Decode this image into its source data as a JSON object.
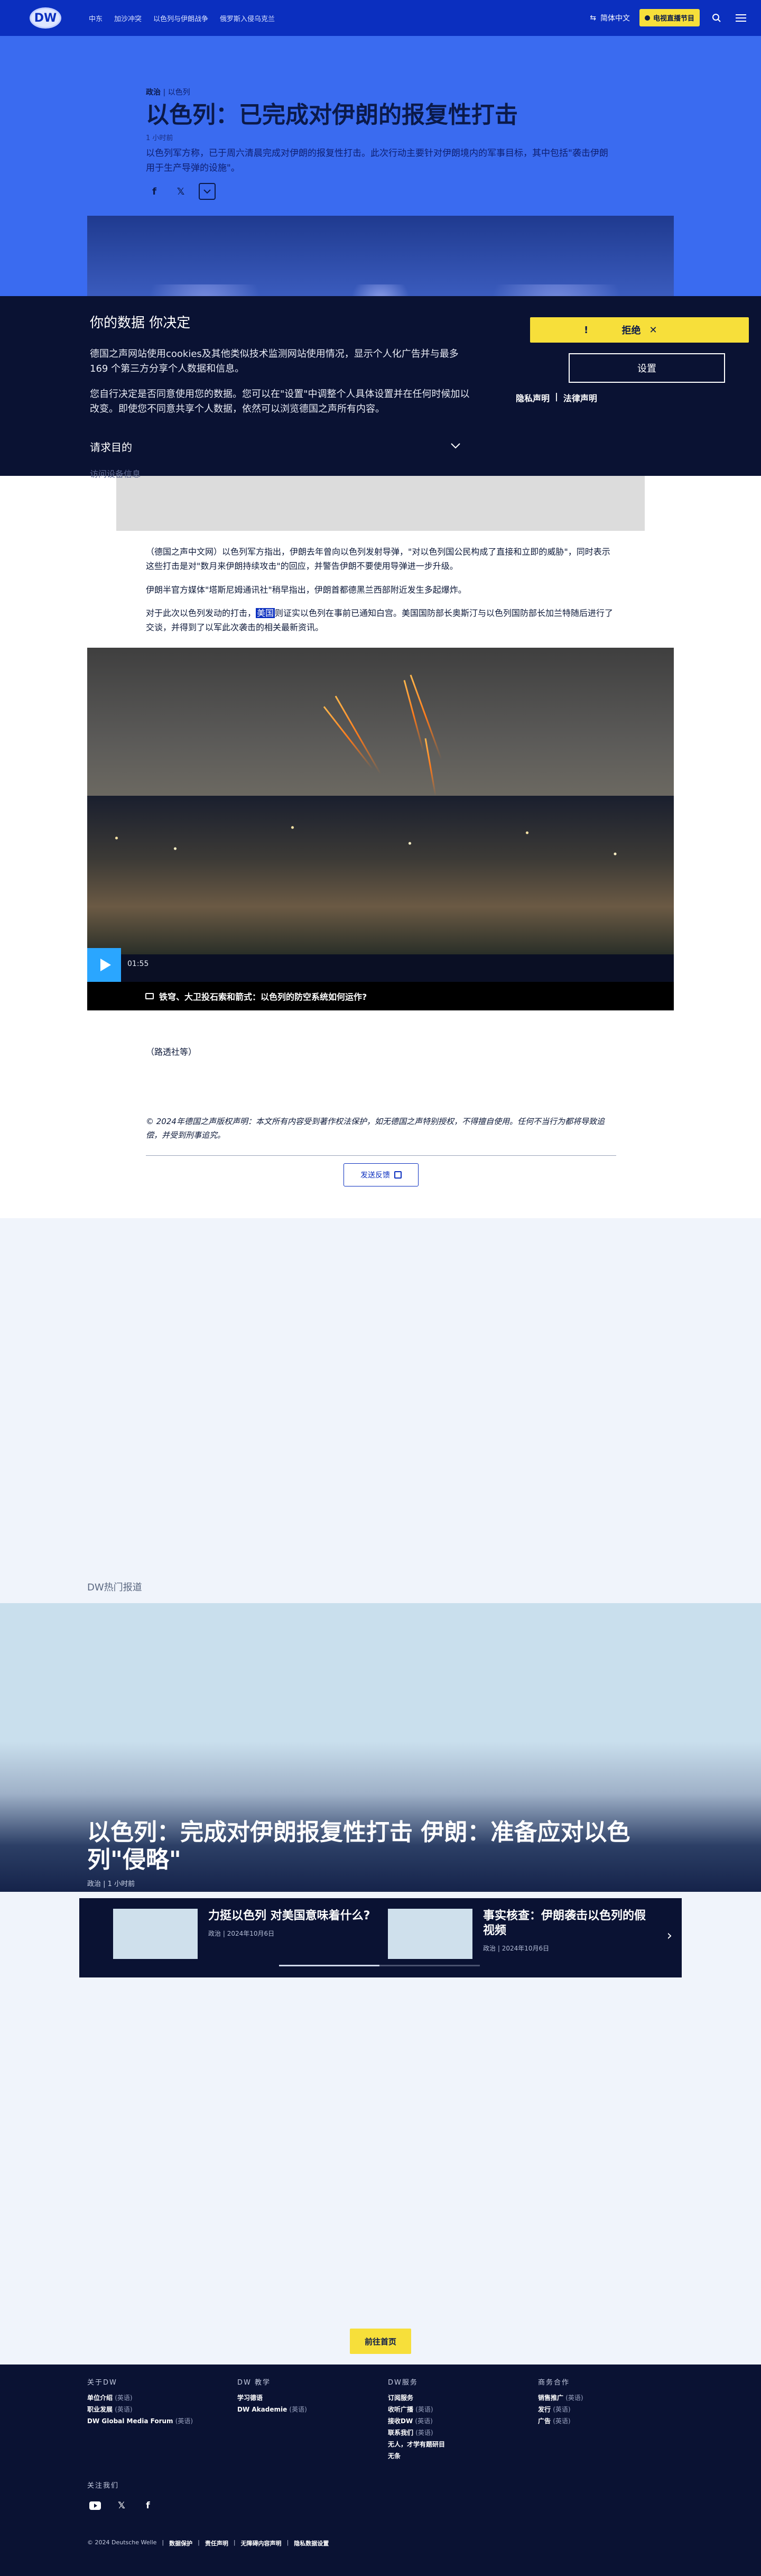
{
  "header": {
    "logo": "DW",
    "nav": [
      "中东",
      "加沙冲突",
      "以色列与伊朗战争",
      "俄罗斯入侵乌克兰"
    ],
    "language": "简体中文",
    "live_label": "电视直播节目"
  },
  "article": {
    "kicker": "政治",
    "kicker_tag": "以色列",
    "title": "以色列：已完成对伊朗的报复性打击",
    "time": "1 小时前",
    "lead": "以色列军方称，已于周六清晨完成对伊朗的报复性打击。此次行动主要针对伊朗境内的军事目标，其中包括\"袭击伊朗用于生产导弹的设施\"。",
    "paragraphs": [
      "（德国之声中文网）以色列军方指出，伊朗去年曾向以色列发射导弹，\"对以色列国公民构成了直接和立即的威胁\"，同时表示这些打击是对\"数月来伊朗持续攻击\"的回应，并警告伊朗不要使用导弹进一步升级。",
      "伊朗半官方媒体\"塔斯尼姆通讯社\"稍早指出，伊朗首都德黑兰西部附近发生多起爆炸。"
    ],
    "p3_before": "对于此次以色列发动的打击，",
    "p3_highlight": "美国",
    "p3_after": "则证实以色列在事前已通知白宫。美国国防部长奥斯汀与以色列国防部长加兰特随后进行了交谈，并得到了以军此次袭击的相关最新资讯。",
    "video_duration": "01:55",
    "video_caption": "铁穹、大卫投石索和箭式：以色列的防空系统如何运作?",
    "source": "（路透社等）",
    "copyright": "© 2024年德国之声版权声明：本文所有内容受到著作权法保护，如无德国之声特别授权，不得擅自使用。任何不当行为都将导致追偿，并受到刑事追究。",
    "feedback_label": "发送反馈"
  },
  "cookie": {
    "title": "你的数据 你决定",
    "p1": "德国之声网站使用cookies及其他类似技术监测网站使用情况，显示个人化广告并与最多169 个第三方分享个人数据和信息。",
    "p2": "您自行决定是否同意使用您的数据。您可以在\"设置\"中调整个人具体设置并在任何时候加以改变。即使您不同意共享个人数据，依然可以浏览德国之声所有内容。",
    "purpose": "请求目的",
    "peek_text": "访问设备信息",
    "reject_label": "拒绝",
    "settings_label": "设置",
    "privacy_label": "隐私声明",
    "legal_label": "法律声明"
  },
  "hot": {
    "label": "DW热门报道",
    "title": "以色列：完成对伊朗报复性打击 伊朗：准备应对以色列\"侵略\"",
    "meta_cat": "政治",
    "meta_time": "1 小时前",
    "cards": [
      {
        "title": "力挺以色列 对美国意味着什么?",
        "cat": "政治",
        "date": "2024年10月6日"
      },
      {
        "title": "事实核查：伊朗袭击以色列的假视频",
        "cat": "政治",
        "date": "2024年10月6日"
      }
    ],
    "progress_fraction": 0.5
  },
  "home_button": "前往首页",
  "footer": {
    "cols": [
      {
        "title": "关于DW",
        "items": [
          {
            "label": "单位介绍",
            "note": "(英语)"
          },
          {
            "label": "职业发展",
            "note": "(英语)"
          },
          {
            "label": "DW Global Media Forum",
            "note": "(英语)"
          }
        ]
      },
      {
        "title": "DW 教学",
        "items": [
          {
            "label": "学习德语",
            "note": ""
          },
          {
            "label": "DW Akademie",
            "note": "(英语)"
          }
        ]
      },
      {
        "title": "DW服务",
        "items": [
          {
            "label": "订阅服务",
            "note": ""
          },
          {
            "label": "收听广播",
            "note": "(英语)"
          },
          {
            "label": "接收DW",
            "note": "(英语)"
          },
          {
            "label": "联系我们",
            "note": "(英语)"
          },
          {
            "label": "无人，才学有题研目",
            "note": ""
          },
          {
            "label": "无条",
            "note": ""
          }
        ]
      },
      {
        "title": "商务合作",
        "items": [
          {
            "label": "销售推广",
            "note": "(英语)"
          },
          {
            "label": "发行",
            "note": "(英语)"
          },
          {
            "label": "广告",
            "note": "(英语)"
          }
        ]
      }
    ],
    "follow": "关注我们",
    "bottom": [
      "© 2024 Deutsche Welle",
      "数据保护",
      "责任声明",
      "无障碍内容声明",
      "隐私数据设置"
    ]
  }
}
